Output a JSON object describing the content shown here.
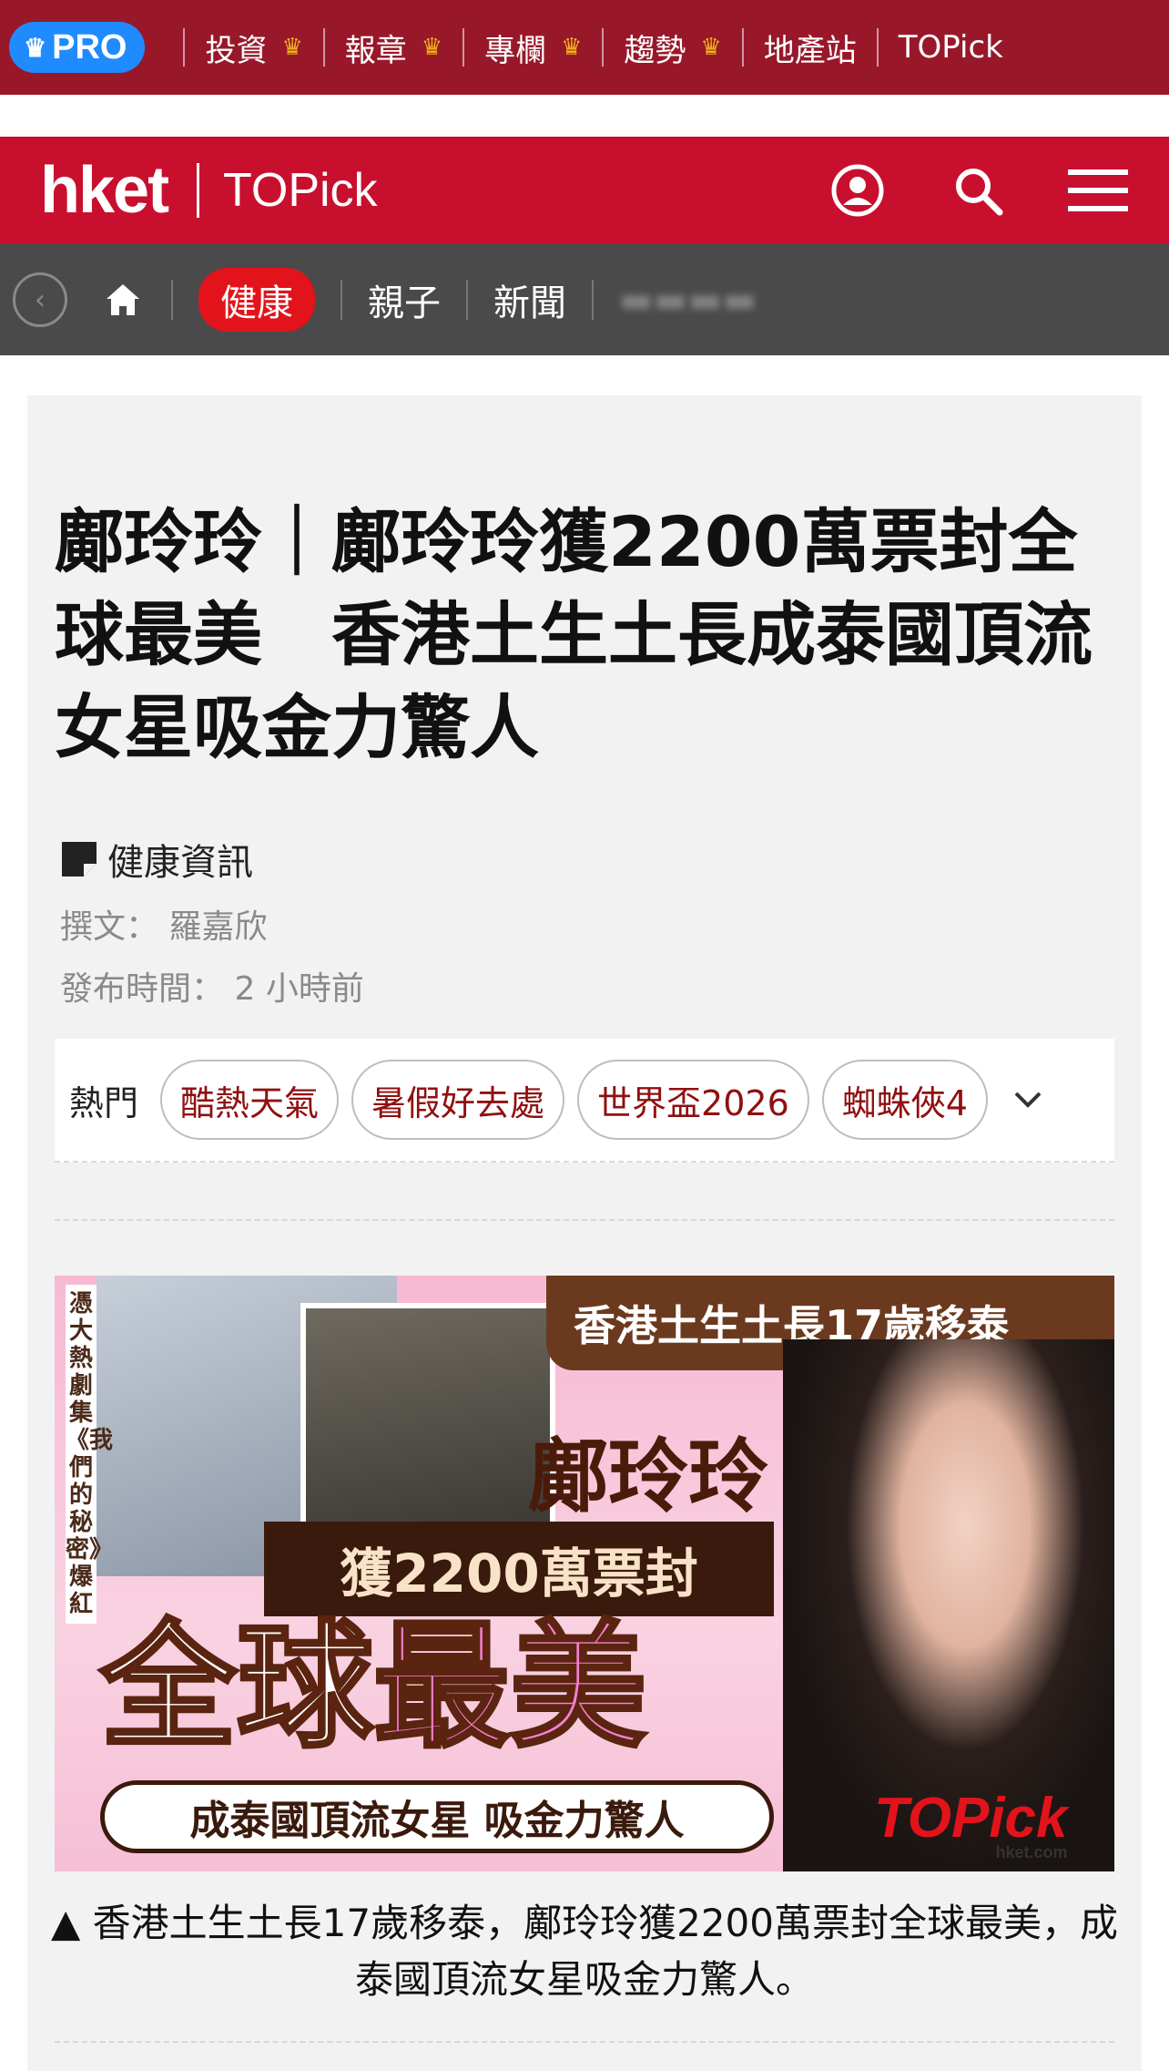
{
  "pro_bar": {
    "badge": "PRO",
    "items": [
      {
        "label": "投資",
        "premium": true
      },
      {
        "label": "報章",
        "premium": true
      },
      {
        "label": "專欄",
        "premium": true
      },
      {
        "label": "趨勢",
        "premium": true
      },
      {
        "label": "地產站",
        "premium": false
      },
      {
        "label": "TOPick",
        "premium": false
      }
    ],
    "crown_color": "#f2b21c",
    "badge_color": "#1f8bff",
    "bar_color": "#98182a"
  },
  "header": {
    "logo": "hket",
    "sub_brand": "TOPick",
    "icons": [
      "user-icon",
      "search-icon",
      "menu-icon"
    ],
    "color": "#c8102e"
  },
  "section_nav": {
    "items": [
      "健康",
      "親子",
      "新聞"
    ],
    "active": "健康",
    "active_color": "#e3131b"
  },
  "article": {
    "title": "鄺玲玲｜鄺玲玲獲2200萬票封全球最美　香港土生土長成泰國頂流女星吸金力驚人",
    "category": "健康資訊",
    "author_label": "撰文：",
    "author": "羅嘉欣",
    "published_label": "發布時間：",
    "published": "2 小時前",
    "hot_label": "熱門",
    "hot_tags": [
      "酷熱天氣",
      "暑假好去處",
      "世界盃2026",
      "蜘蛛俠4"
    ],
    "hero": {
      "vertical_text": "憑大熱劇集《我們的秘密》爆紅",
      "top_banner": "香港土生土長17歲移泰",
      "name": "鄺玲玲",
      "sub": "獲2200萬票封",
      "big_white": "全球",
      "big_pink": "最美",
      "bottom": "成泰國頂流女星 吸金力驚人",
      "brand": "TOPick",
      "brand_domain": "hket.com"
    },
    "caption_marker": "▲",
    "caption": "香港土生土長17歲移泰，鄺玲玲獲2200萬票封全球最美，成泰國頂流女星吸金力驚人。"
  }
}
